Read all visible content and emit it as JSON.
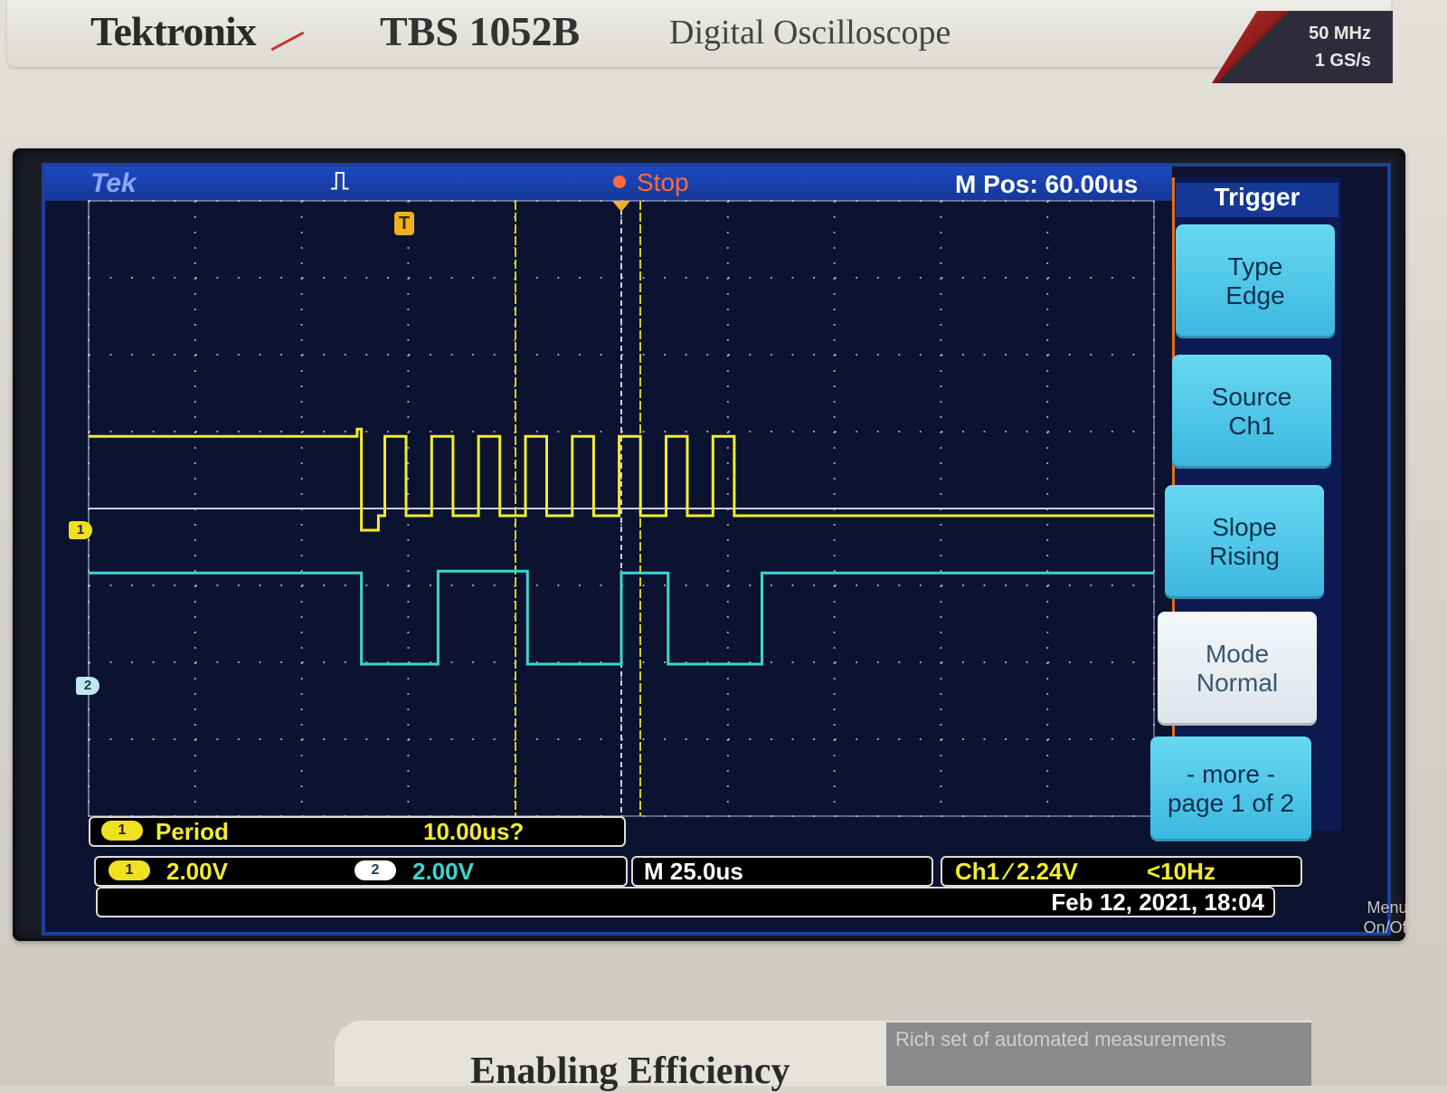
{
  "instrument": {
    "brand": "Tektronix",
    "model": "TBS 1052B",
    "description": "Digital Oscilloscope",
    "bandwidth": "50 MHz",
    "sample_rate": "1 GS/s",
    "slogan": "Enabling Efficiency",
    "feature_text": "Rich set of automated measurements",
    "menu_onoff": "Menu On/Off"
  },
  "status": {
    "logo": "Tek",
    "acquire_icon": "⎍",
    "run_state": "Stop",
    "horizontal_position": "M Pos: 60.00us"
  },
  "menu": {
    "title": "Trigger",
    "items": [
      {
        "line1": "Type",
        "line2": "Edge"
      },
      {
        "line1": "Source",
        "line2": "Ch1"
      },
      {
        "line1": "Slope",
        "line2": "Rising"
      },
      {
        "line1": "Mode",
        "line2": "Normal"
      },
      {
        "line1": "- more -",
        "line2": "page 1 of 2"
      }
    ]
  },
  "markers": {
    "trigger": "T",
    "ch1": "1",
    "ch2": "2"
  },
  "measurement": {
    "channel": "1",
    "label": "Period",
    "value": "10.00us?"
  },
  "vertical": {
    "ch1_badge": "1",
    "ch1_scale": "2.00V",
    "ch2_badge": "2",
    "ch2_scale": "2.00V"
  },
  "horizontal": {
    "timebase": "M 25.0us"
  },
  "trigger_readout": {
    "text": "Ch1 ∕ 2.24V",
    "frequency": "<10Hz"
  },
  "datetime": "Feb 12, 2021, 18:04",
  "colors": {
    "ch1": "#f2ec30",
    "ch2": "#3ad6d0",
    "cursor": "#d8cc20",
    "graticule": "#c9cfdf"
  },
  "chart_data": {
    "type": "line",
    "x": [
      0,
      25,
      50,
      75,
      100,
      125,
      150,
      175,
      200,
      225
    ],
    "series": [
      {
        "name": "1",
        "y_divisions": [
          1.8,
          1.8,
          0.0,
          1.8,
          0.0,
          1.8,
          0.0,
          1.8,
          0.0,
          0.0
        ]
      },
      {
        "name": "2",
        "y_divisions": [
          1.6,
          1.6,
          0.0,
          1.6,
          0.0,
          1.6,
          0.0,
          1.6,
          1.6,
          1.6
        ]
      }
    ],
    "xlabel": "",
    "ylabel": "",
    "grid": true
  }
}
